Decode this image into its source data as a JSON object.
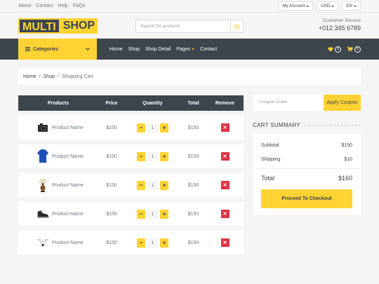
{
  "topbar": {
    "links": [
      "About",
      "Contact",
      "Help",
      "FAQs"
    ],
    "my_account": "My Account",
    "currency": "USD",
    "language": "EN"
  },
  "brand": {
    "logo_part1": "MULTI",
    "logo_part2": "SHOP",
    "search_placeholder": "Search for products",
    "customer_service_label": "Customer Service",
    "phone": "+012 345 6789"
  },
  "nav": {
    "categories_label": "Categories",
    "links": [
      "Home",
      "Shop",
      "Shop Detail",
      "Pages",
      "Contact"
    ],
    "active_link": "Pages",
    "wishlist_count": "0",
    "cart_count": "0"
  },
  "breadcrumb": {
    "items": [
      "Home",
      "Shop"
    ],
    "current": "Shopping Cart"
  },
  "cart": {
    "headers": [
      "Products",
      "Price",
      "Quantity",
      "Total",
      "Remove"
    ],
    "rows": [
      {
        "icon": "camera-icon",
        "name": "Product Name",
        "price": "$150",
        "qty": "1",
        "total": "$150"
      },
      {
        "icon": "shirt-icon",
        "name": "Product Name",
        "price": "$150",
        "qty": "1",
        "total": "$150"
      },
      {
        "icon": "lamp-icon",
        "name": "Product Name",
        "price": "$150",
        "qty": "1",
        "total": "$150"
      },
      {
        "icon": "shoe-icon",
        "name": "Product Name",
        "price": "$150",
        "qty": "1",
        "total": "$150"
      },
      {
        "icon": "drone-icon",
        "name": "Product Name",
        "price": "$150",
        "qty": "1",
        "total": "$150"
      }
    ]
  },
  "coupon": {
    "placeholder": "Coupon Code",
    "button": "Apply Coupon"
  },
  "summary": {
    "title": "CART SUMMARY",
    "subtotal_label": "Subtotal",
    "subtotal": "$150",
    "shipping_label": "Shipping",
    "shipping": "$10",
    "total_label": "Total",
    "total": "$160",
    "checkout": "Proceed To Checkout"
  },
  "colors": {
    "accent": "#ffd333",
    "dark": "#3d464d",
    "danger": "#dc3545"
  }
}
